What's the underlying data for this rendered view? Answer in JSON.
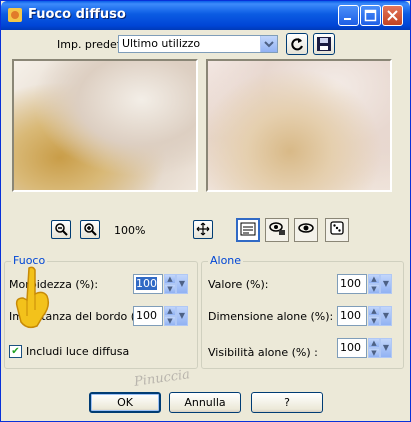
{
  "window": {
    "title": "Fuoco diffuso"
  },
  "titlebar_buttons": {
    "minimize_icon": "minimize-icon",
    "maximize_icon": "maximize-icon",
    "close_icon": "close-icon"
  },
  "preset": {
    "label": "Imp. predef.:",
    "value": "Ultimo utilizzo"
  },
  "zoom": {
    "level": "100%"
  },
  "fuoco": {
    "legend": "Fuoco",
    "morbidezza_label": "Morbidezza (%):",
    "morbidezza_value": "100",
    "importanza_label": "Importanza del bordo (%):",
    "importanza_value": "100",
    "luce_label": "Includi luce diffusa",
    "luce_checked": true
  },
  "alone": {
    "legend": "Alone",
    "valore_label": "Valore (%):",
    "valore_value": "100",
    "dimensione_label": "Dimensione alone (%):",
    "dimensione_value": "100",
    "visibilita_label": "Visibilità alone (%) :",
    "visibilita_value": "100"
  },
  "buttons": {
    "ok": "OK",
    "cancel": "Annulla",
    "help": "?"
  },
  "watermark": "Pinuccia",
  "colors": {
    "title_bar": "#0b5ce3",
    "dialog_bg": "#ece9d8",
    "group_legend": "#0046d5"
  }
}
